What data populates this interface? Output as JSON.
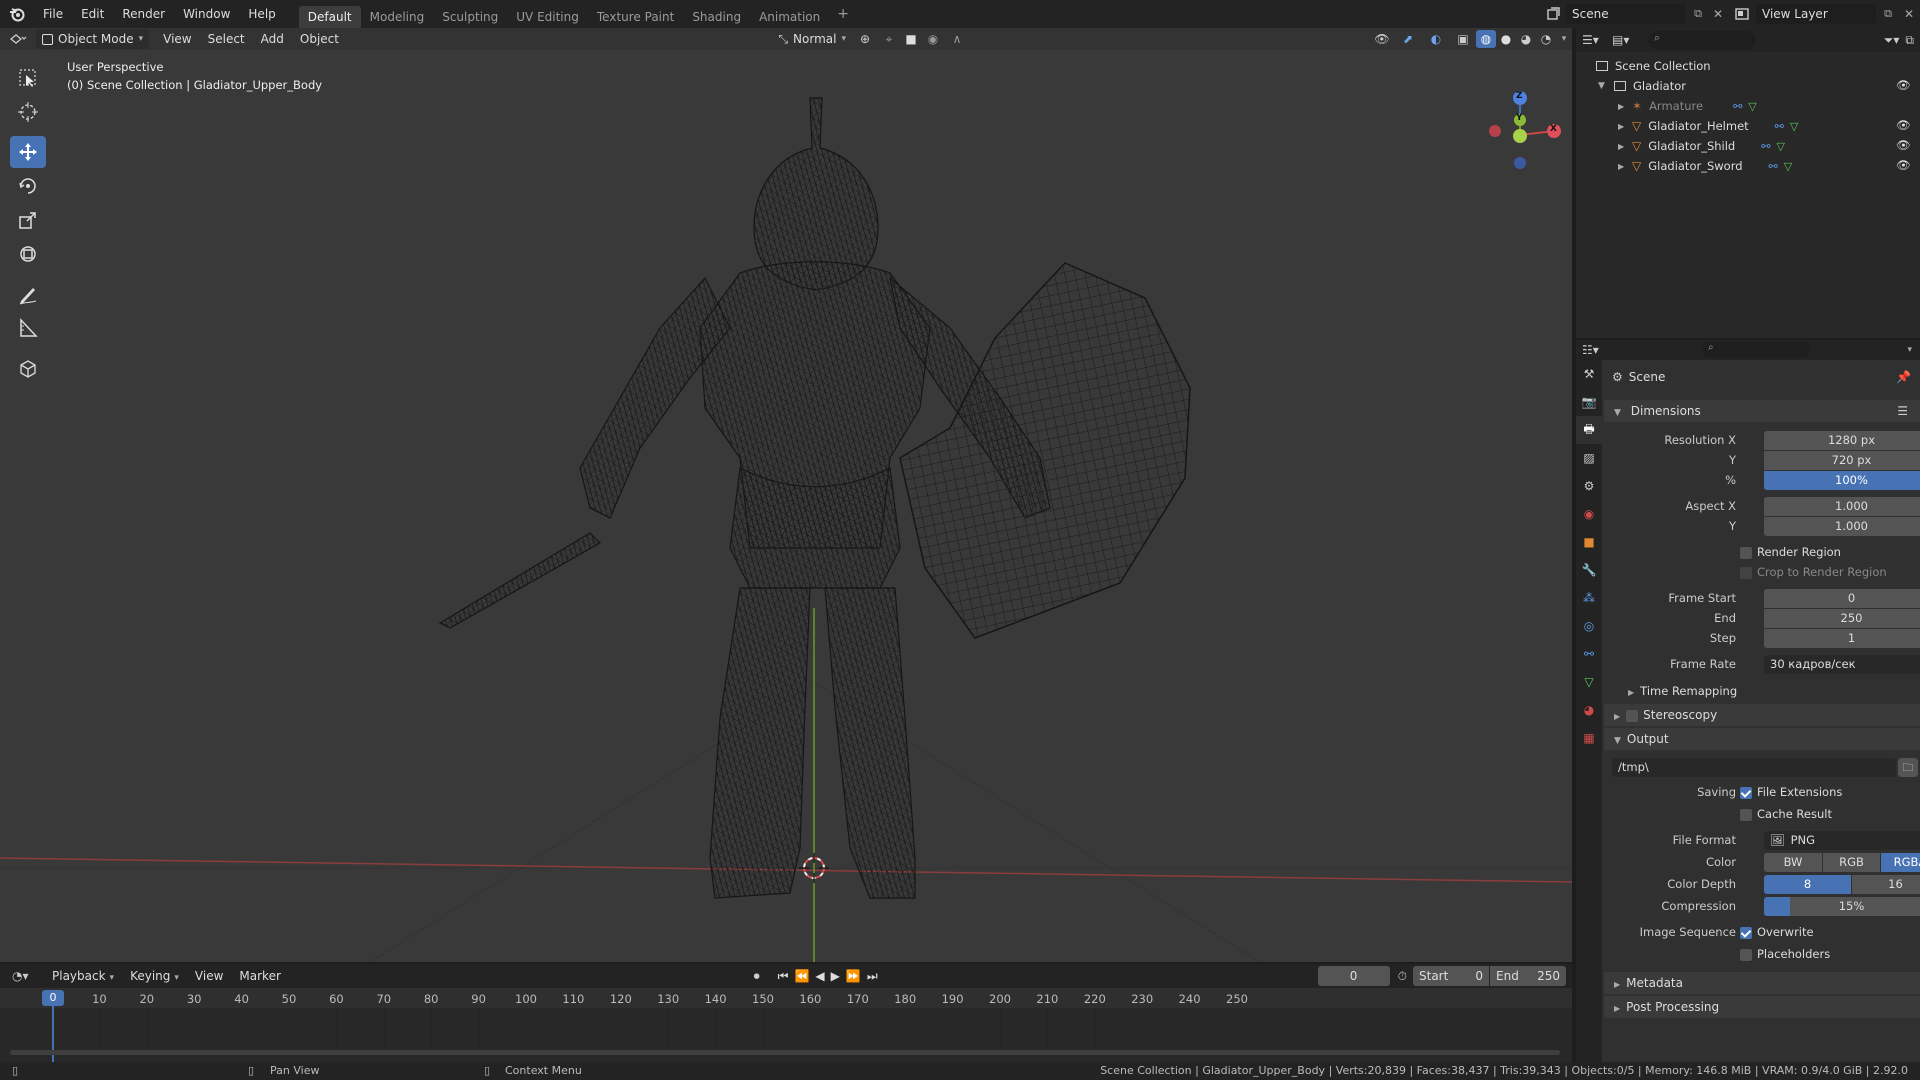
{
  "topbar": {
    "menus": [
      "File",
      "Edit",
      "Render",
      "Window",
      "Help"
    ],
    "workspaces": [
      "Default",
      "Modeling",
      "Sculpting",
      "UV Editing",
      "Texture Paint",
      "Shading",
      "Animation"
    ],
    "add_tab": "+",
    "scene_name": "Scene",
    "view_layer": "View Layer"
  },
  "viewport": {
    "mode": "Object Mode",
    "menus": [
      "View",
      "Select",
      "Add",
      "Object"
    ],
    "orientation": "Normal",
    "perspective_label": "User Perspective",
    "collection_label": "(0) Scene Collection | Gladiator_Upper_Body",
    "gizmo": {
      "z": "Z",
      "y": "Y",
      "x": "X"
    }
  },
  "outliner": {
    "root": "Scene Collection",
    "collection": "Gladiator",
    "items": [
      {
        "name": "Armature",
        "dim": true
      },
      {
        "name": "Gladiator_Helmet",
        "dim": false
      },
      {
        "name": "Gladiator_Shild",
        "dim": false
      },
      {
        "name": "Gladiator_Sword",
        "dim": false
      }
    ]
  },
  "properties": {
    "context": "Scene",
    "dimensions_label": "Dimensions",
    "resolution_x_label": "Resolution X",
    "resolution_x": "1280 px",
    "y_label": "Y",
    "resolution_y": "720 px",
    "pct_label": "%",
    "resolution_pct": "100%",
    "aspect_x_label": "Aspect X",
    "aspect_x": "1.000",
    "aspect_y": "1.000",
    "render_region": "Render Region",
    "crop_region": "Crop to Render Region",
    "frame_start_label": "Frame Start",
    "frame_start": "0",
    "end_label": "End",
    "frame_end": "250",
    "step_label": "Step",
    "frame_step": "1",
    "frame_rate_label": "Frame Rate",
    "frame_rate": "30 кадров/сек",
    "time_remapping": "Time Remapping",
    "stereoscopy": "Stereoscopy",
    "output_label": "Output",
    "output_path": "/tmp\\",
    "saving_label": "Saving",
    "file_extensions": "File Extensions",
    "cache_result": "Cache Result",
    "file_format_label": "File Format",
    "file_format": "PNG",
    "color_label": "Color",
    "color_modes": [
      "BW",
      "RGB",
      "RGBA"
    ],
    "color_depth_label": "Color Depth",
    "color_depths": [
      "8",
      "16"
    ],
    "compression_label": "Compression",
    "compression": "15%",
    "compression_value": 0.15,
    "image_sequence_label": "Image Sequence",
    "overwrite": "Overwrite",
    "placeholders": "Placeholders",
    "metadata": "Metadata",
    "post_processing": "Post Processing"
  },
  "timeline": {
    "menus": [
      "Playback",
      "Keying",
      "View",
      "Marker"
    ],
    "current_frame": "0",
    "start_label": "Start",
    "start": "0",
    "end_label": "End",
    "end": "250",
    "ticks": [
      "0",
      "10",
      "20",
      "30",
      "40",
      "50",
      "60",
      "70",
      "80",
      "90",
      "100",
      "110",
      "120",
      "130",
      "140",
      "150",
      "160",
      "170",
      "180",
      "190",
      "200",
      "210",
      "220",
      "230",
      "240",
      "250"
    ]
  },
  "statusbar": {
    "pan_view": "Pan View",
    "context_menu": "Context Menu",
    "stats": "Scene Collection | Gladiator_Upper_Body | Verts:20,839 | Faces:38,437 | Tris:39,343 | Objects:0/5 | Memory: 146.8 MiB | VRAM: 0.9/4.0 GiB | 2.92.0"
  }
}
